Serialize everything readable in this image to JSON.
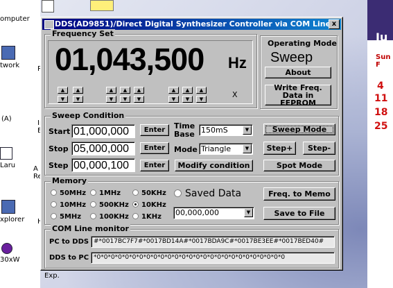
{
  "desktop": {
    "icons": [
      {
        "label": "omputer"
      },
      {
        "label": "twork"
      },
      {
        "label": "(A)"
      },
      {
        "label": "Laru"
      },
      {
        "label": "xplorer"
      },
      {
        "label": "30xW"
      }
    ],
    "mid_icons": [
      {
        "label": "R"
      },
      {
        "label": "In\nE"
      },
      {
        "label": "A\nRe"
      },
      {
        "label": "H"
      },
      {
        "label": "Exp."
      }
    ],
    "calendar": {
      "month": "Ju",
      "sun_label": "Sun F",
      "days": [
        "4",
        "11",
        "18",
        "25"
      ]
    }
  },
  "window": {
    "title": "DDS(AD9851)/Direct Digital Synthesizer Controller via COM Line",
    "close_glyph": "x"
  },
  "frequency_set": {
    "label": "Frequency Set",
    "value": "01,043,500",
    "unit": "Hz",
    "marker": "X",
    "arrow_up": "▲",
    "arrow_down": "▼"
  },
  "operating_mode": {
    "label": "Operating Mode",
    "mode": "Sweep",
    "about_label": "About",
    "write_label": "Write Freq. Data in EEPROM"
  },
  "sweep_condition": {
    "label": "Sweep Condition",
    "start_label": "Start",
    "start_value": "01,000,000",
    "stop_label": "Stop",
    "stop_value": "05,000,000",
    "step_label": "Step",
    "step_value": "00,000,100",
    "enter_label": "Enter",
    "time_base_label": "Time Base",
    "time_base_value": "150mS",
    "mode_label": "Mode",
    "mode_value": "Triangle",
    "modify_label": "Modify condition",
    "sweep_mode_label": "Sweep Mode",
    "step_plus_label": "Step+",
    "step_minus_label": "Step-",
    "spot_mode_label": "Spot Mode"
  },
  "memory": {
    "label": "Memory",
    "options": [
      "50MHz",
      "1MHz",
      "50KHz",
      "10MHz",
      "500KHz",
      "10KHz",
      "5MHz",
      "100KHz",
      "1KHz"
    ],
    "selected": "10KHz",
    "saved_data_label": "Saved Data",
    "saved_value": "00,000,000",
    "freq_to_memo_label": "Freq. to Memo",
    "save_to_file_label": "Save to File"
  },
  "com_monitor": {
    "label": "COM Line monitor",
    "pc_to_dds_label": "PC to DDS",
    "pc_to_dds_value": "#*0017BC7F7#*0017BD14A#*0017BDA9C#*0017BE3EE#*0017BED40#",
    "dds_to_pc_label": "DDS to PC",
    "dds_to_pc_value": "*0*0*0*0*0*0*0*0*0*0*0*0*0*0*0*0*0*0*0*0*0*0*0*0*0*0*0"
  }
}
